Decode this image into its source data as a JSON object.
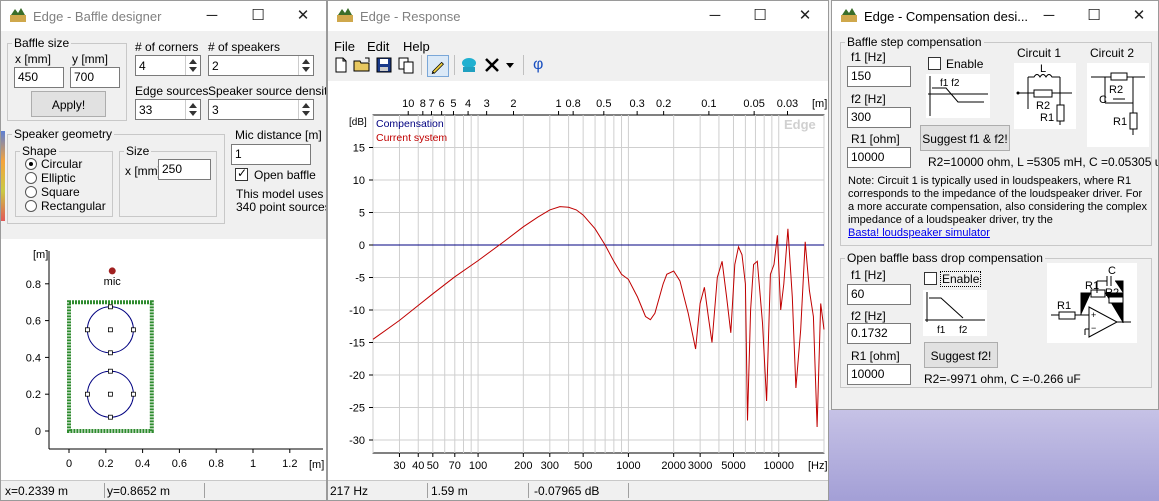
{
  "background": {
    "top_color": "#c6c2e6",
    "bottom_color": "#a39fd6"
  },
  "baffle": {
    "title": "Edge - Baffle designer",
    "baffle_size": {
      "label": "Baffle size",
      "x_label": "x [mm]",
      "x_value": "450",
      "y_label": "y [mm]",
      "y_value": "700",
      "apply_label": "Apply!"
    },
    "corners": {
      "label": "# of corners",
      "value": "4"
    },
    "speakers": {
      "label": "# of speakers",
      "value": "2"
    },
    "edge_sources": {
      "label": "Edge sources",
      "value": "33"
    },
    "density": {
      "label": "Speaker source density",
      "value": "3"
    },
    "geometry": {
      "label": "Speaker geometry",
      "shape_label": "Shape",
      "shapes": [
        "Circular",
        "Elliptic",
        "Square",
        "Rectangular"
      ],
      "selected_shape": "Circular",
      "size_label": "Size",
      "size_x_label": "x [mm]",
      "size_x_value": "250"
    },
    "mic_distance": {
      "label": "Mic distance [m]",
      "value": "1"
    },
    "open_baffle": {
      "label": "Open baffle",
      "checked": true
    },
    "model_text_1": "This model uses",
    "model_text_2": "340 point sources",
    "plot": {
      "unit": "[m]",
      "x_ticks": [
        "0",
        "0.2",
        "0.4",
        "0.6",
        "0.8",
        "1",
        "1.2"
      ],
      "x_unit": "[m]",
      "y_ticks": [
        "0.8",
        "0.6",
        "0.4",
        "0.2",
        "0"
      ],
      "mic_label": "mic",
      "baffle_color": "#2e8b2e",
      "speaker_color": "#000080",
      "mic_color": "#a02020"
    },
    "status": {
      "x": "x=0.2339 m",
      "y": "y=0.8652 m"
    }
  },
  "response": {
    "title": "Edge - Response",
    "menu": [
      "File",
      "Edit",
      "Help"
    ],
    "toolbar_icons": [
      "new-file-icon",
      "open-folder-icon",
      "save-icon",
      "copy-icon",
      "pencil-icon",
      "speaker-icon",
      "delete-icon",
      "dropdown-arrow-icon",
      "phase-icon"
    ],
    "phase_symbol": "φ",
    "status": {
      "freq": "217 Hz",
      "dist": "1.59 m",
      "level": "-0.07965 dB"
    }
  },
  "chart_data": {
    "type": "line",
    "ylabel": "[dB]",
    "xlabel": "[Hz]",
    "top_axis_label": "[m]",
    "watermark": "Edge",
    "xscale": "log",
    "xlim": [
      20,
      20000
    ],
    "ylim": [
      -32,
      20
    ],
    "y_ticks": [
      15,
      10,
      5,
      0,
      -5,
      -10,
      -15,
      -20,
      -25,
      -30
    ],
    "x_ticks": [
      {
        "v": 30,
        "label": "30"
      },
      {
        "v": 40,
        "label": "40"
      },
      {
        "v": 50,
        "label": "50"
      },
      {
        "v": 70,
        "label": "70"
      },
      {
        "v": 100,
        "label": "100"
      },
      {
        "v": 200,
        "label": "200"
      },
      {
        "v": 300,
        "label": "300"
      },
      {
        "v": 500,
        "label": "500"
      },
      {
        "v": 1000,
        "label": "1000"
      },
      {
        "v": 2000,
        "label": "2000"
      },
      {
        "v": 3000,
        "label": "3000"
      },
      {
        "v": 5000,
        "label": "5000"
      },
      {
        "v": 10000,
        "label": "10000"
      }
    ],
    "top_ticks": [
      {
        "label": "10",
        "f": 34.3
      },
      {
        "label": "8",
        "f": 42.9
      },
      {
        "label": "7",
        "f": 49
      },
      {
        "label": "6",
        "f": 57.2
      },
      {
        "label": "5",
        "f": 68.6
      },
      {
        "label": "4",
        "f": 85.8
      },
      {
        "label": "3",
        "f": 114
      },
      {
        "label": "2",
        "f": 172
      },
      {
        "label": "1",
        "f": 343
      },
      {
        "label": "0.8",
        "f": 429
      },
      {
        "label": "0.5",
        "f": 686
      },
      {
        "label": "0.3",
        "f": 1143
      },
      {
        "label": "0.2",
        "f": 1715
      },
      {
        "label": "0.1",
        "f": 3430
      },
      {
        "label": "0.05",
        "f": 6860
      },
      {
        "label": "0.03",
        "f": 11433
      }
    ],
    "grid": true,
    "legend_position": "top-left",
    "series": [
      {
        "name": "Compensation",
        "color": "#000080",
        "points": [
          [
            20,
            0
          ],
          [
            20000,
            0
          ]
        ]
      },
      {
        "name": "Current system",
        "color": "#c00000",
        "points": [
          [
            20,
            -14.5
          ],
          [
            30,
            -11.6
          ],
          [
            40,
            -9.3
          ],
          [
            50,
            -7.5
          ],
          [
            70,
            -4.9
          ],
          [
            100,
            -2.4
          ],
          [
            150,
            0.6
          ],
          [
            200,
            2.8
          ],
          [
            250,
            4.3
          ],
          [
            300,
            5.4
          ],
          [
            350,
            5.9
          ],
          [
            400,
            5.8
          ],
          [
            450,
            5.4
          ],
          [
            500,
            4.6
          ],
          [
            600,
            2.5
          ],
          [
            700,
            0.0
          ],
          [
            800,
            -2.5
          ],
          [
            900,
            -4.5
          ],
          [
            1000,
            -5.3
          ],
          [
            1150,
            -8.0
          ],
          [
            1300,
            -11.0
          ],
          [
            1400,
            -11.5
          ],
          [
            1500,
            -10.5
          ],
          [
            1700,
            -6.0
          ],
          [
            1800,
            -4.5
          ],
          [
            2000,
            -4.0
          ],
          [
            2200,
            -5.5
          ],
          [
            2500,
            -10.5
          ],
          [
            2800,
            -16.0
          ],
          [
            3000,
            -9.0
          ],
          [
            3200,
            -6.5
          ],
          [
            3400,
            -11.0
          ],
          [
            3600,
            -15.0
          ],
          [
            3900,
            -5.0
          ],
          [
            4200,
            -2.5
          ],
          [
            4500,
            -8.0
          ],
          [
            4800,
            -13.5
          ],
          [
            5100,
            -3.0
          ],
          [
            5400,
            -0.3
          ],
          [
            5700,
            -1.5
          ],
          [
            6000,
            -6.0
          ],
          [
            6200,
            -27.0
          ],
          [
            6500,
            -10.0
          ],
          [
            6800,
            -3.0
          ],
          [
            7200,
            -2.5
          ],
          [
            7800,
            -12.0
          ],
          [
            8300,
            -24.0
          ],
          [
            8800,
            -4.5
          ],
          [
            9300,
            -3.0
          ],
          [
            9800,
            1.5
          ],
          [
            10300,
            -10.0
          ],
          [
            10800,
            -6.0
          ],
          [
            11500,
            2.5
          ],
          [
            12300,
            -8.0
          ],
          [
            13000,
            -22.0
          ],
          [
            14000,
            -13.0
          ],
          [
            15000,
            0.5
          ],
          [
            16000,
            -7.0
          ],
          [
            17000,
            -11.0
          ],
          [
            18000,
            -28.0
          ],
          [
            19000,
            -9.0
          ],
          [
            20000,
            -13.0
          ]
        ]
      }
    ]
  },
  "compensation": {
    "title": "Edge - Compensation desi...",
    "baffle_step": {
      "label": "Baffle step compensation",
      "f1_label": "f1 [Hz]",
      "f1_value": "150",
      "f2_label": "f2 [Hz]",
      "f2_value": "300",
      "r1_label": "R1 [ohm]",
      "r1_value": "10000",
      "enable_label": "Enable",
      "enable_checked": false,
      "graph_label": "f1  f2",
      "circuit1_label": "Circuit 1",
      "circuit2_label": "Circuit 2",
      "c1_parts": [
        "L",
        "R2",
        "R1"
      ],
      "c2_parts": [
        "R2",
        "C",
        "R1"
      ],
      "suggest_label": "Suggest f1 & f2!",
      "result": "R2=10000 ohm, L =5305 mH, C =0.05305 uF"
    },
    "note_lines": [
      "Note: Circuit 1 is typically used in loudspeakers, where R1",
      "corresponds to the impedance of the loudspeaker driver. For",
      "a more accurate compensation, also considering the complex",
      "impedance of a loudspeaker driver, try the"
    ],
    "note_link": "Basta! loudspeaker simulator",
    "open_baffle": {
      "label": "Open baffle bass drop compensation",
      "f1_label": "f1 [Hz]",
      "f1_value": "60",
      "f2_label": "f2 [Hz]",
      "f2_value": "0.1732",
      "r1_label": "R1 [ohm]",
      "r1_value": "10000",
      "enable_label": "Enable",
      "enable_checked": false,
      "graph_f1": "f1",
      "graph_f2": "f2",
      "circuit_parts": [
        "C",
        "R1",
        "R2",
        "R1"
      ],
      "suggest_label": "Suggest f2!",
      "result": "R2=-9971 ohm, C =-0.266 uF"
    }
  }
}
